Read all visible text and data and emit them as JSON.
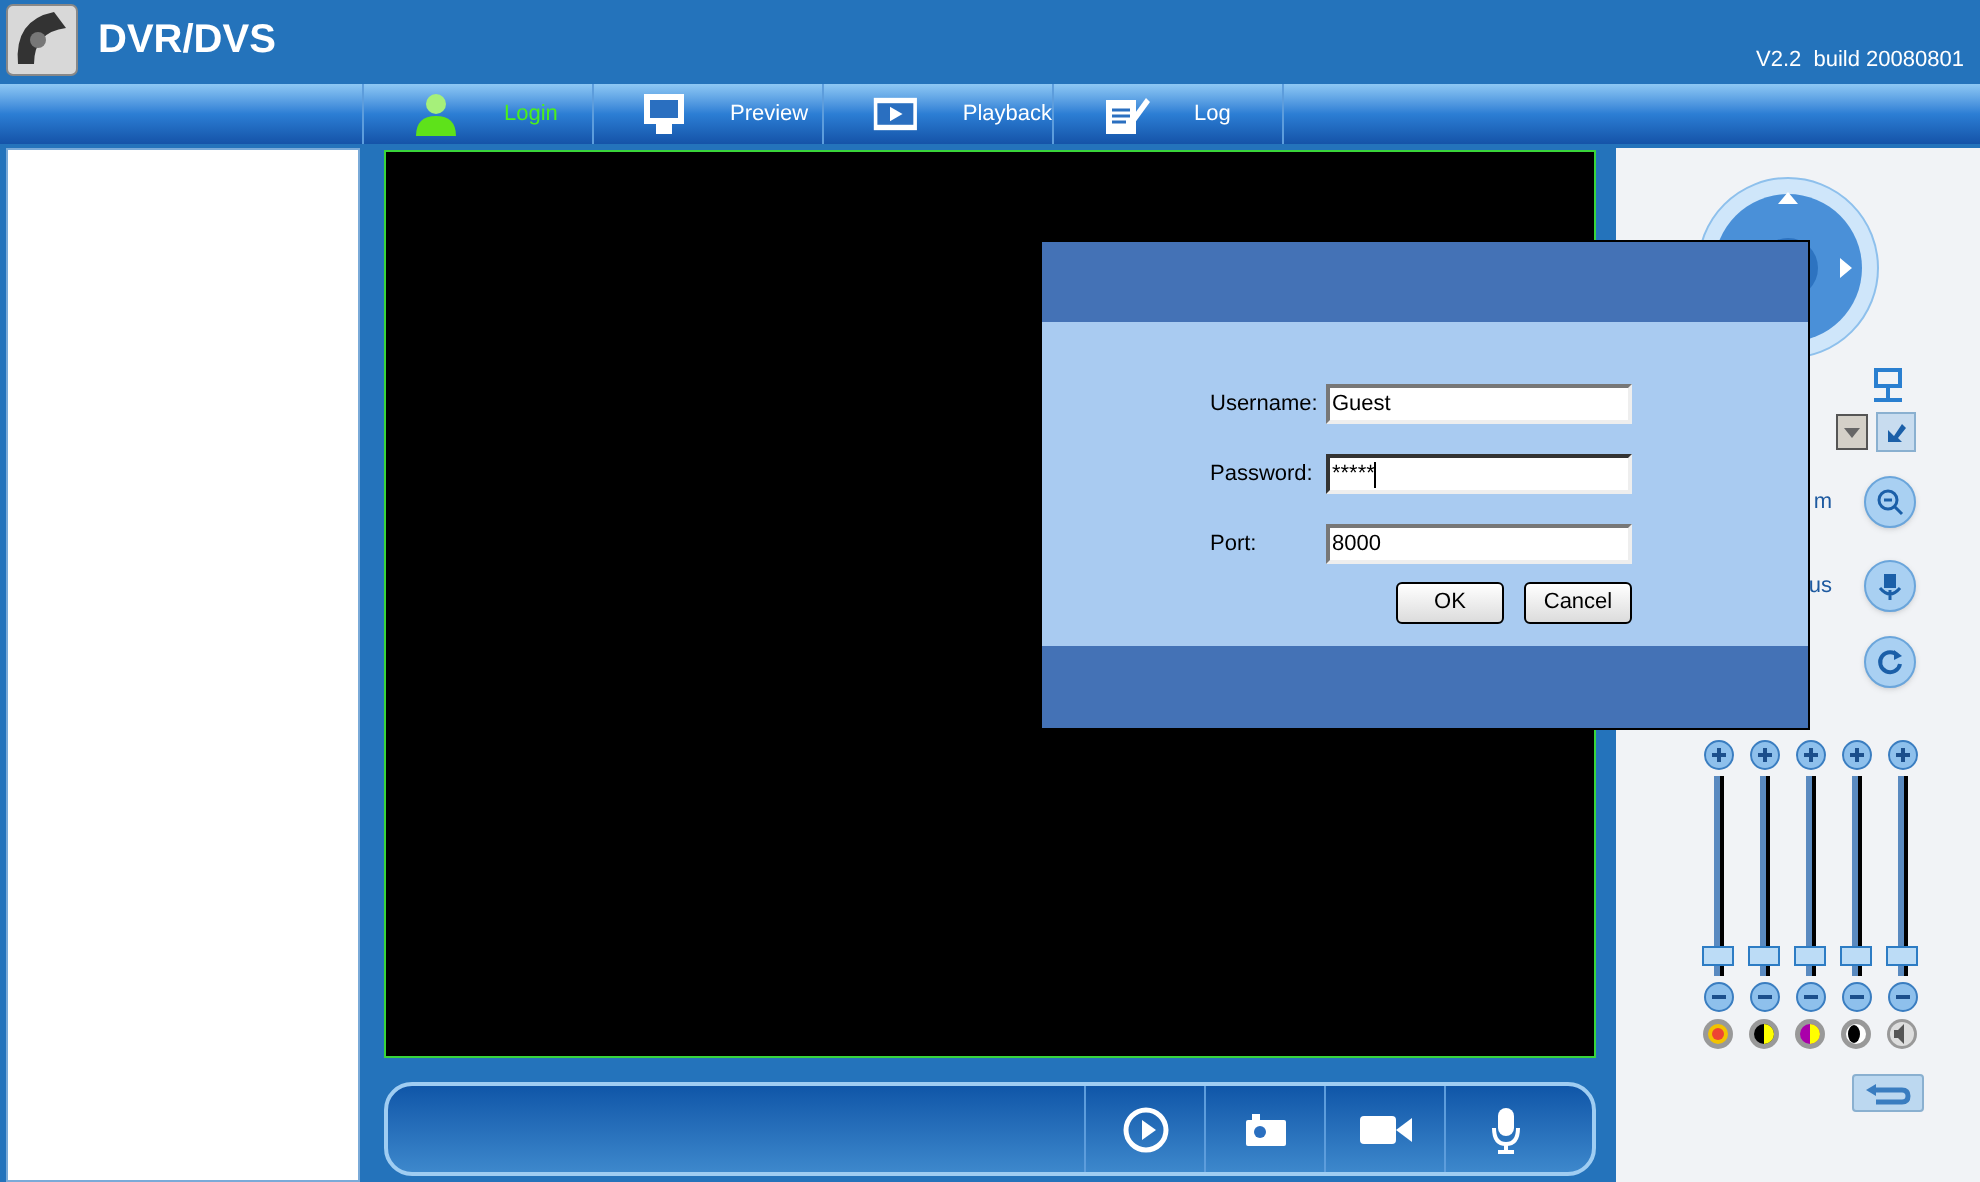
{
  "app": {
    "title": "DVR/DVS",
    "version": "V2.2  build 20080801"
  },
  "nav": [
    {
      "label": "Login",
      "selected": true,
      "kind": "person"
    },
    {
      "label": "Preview",
      "selected": false,
      "kind": "monitor"
    },
    {
      "label": "Playback",
      "selected": false,
      "kind": "film"
    },
    {
      "label": "Log",
      "selected": false,
      "kind": "notepad"
    }
  ],
  "ptz": {
    "zoom_label": "m",
    "focus_label": "us"
  },
  "sliders": [
    {
      "kind": "brightness",
      "level": 0.05
    },
    {
      "kind": "contrast",
      "level": 0.05
    },
    {
      "kind": "saturation",
      "level": 0.05
    },
    {
      "kind": "hue",
      "level": 0.05
    },
    {
      "kind": "volume",
      "level": 0.05
    }
  ],
  "login_dialog": {
    "fields": [
      {
        "label": "Username:",
        "value": "Guest",
        "focused": false
      },
      {
        "label": "Password:",
        "value": "*****",
        "focused": true
      },
      {
        "label": "Port:",
        "value": "8000",
        "focused": false
      }
    ],
    "buttons": [
      "OK",
      "Cancel"
    ]
  }
}
